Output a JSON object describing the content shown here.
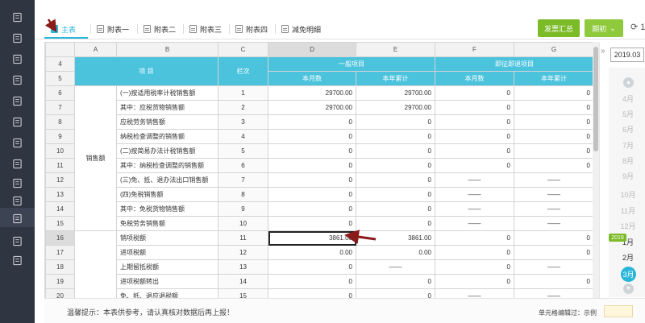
{
  "sidebar": {
    "icons": [
      "report-icon",
      "ledger-icon",
      "invoice-icon",
      "chart-icon",
      "voucher-icon",
      "calendar-icon",
      "document-icon",
      "archive-icon",
      "wallet-icon",
      "payroll-icon",
      "tax-icon",
      "search-report-icon",
      "settings-icon"
    ]
  },
  "tabs": [
    {
      "label": "主表",
      "active": true
    },
    {
      "label": "附表一",
      "active": false
    },
    {
      "label": "附表二",
      "active": false
    },
    {
      "label": "附表三",
      "active": false
    },
    {
      "label": "附表四",
      "active": false
    },
    {
      "label": "减免明细",
      "active": false
    }
  ],
  "toolbar": {
    "summary_label": "发票汇总",
    "period_label": "期初",
    "refresh_label": "⟳ 1"
  },
  "grid": {
    "col_letters": [
      "",
      "A",
      "B",
      "C",
      "D",
      "E",
      "F",
      "G"
    ],
    "header": {
      "item": "项 目",
      "seq": "栏次",
      "general": "一般项目",
      "refund": "即征即退项目",
      "this_month": "本月数",
      "year_total": "本年累计"
    },
    "header_rows": [
      "4",
      "5"
    ],
    "group_label": "销售额",
    "rows": [
      {
        "n": "6",
        "b": "(一)按适用税率计税销售额",
        "c": "1",
        "d": "29700.00",
        "e": "29700.00",
        "f": "0",
        "g": "0"
      },
      {
        "n": "7",
        "b": "其中：应税货物销售额",
        "c": "2",
        "d": "29700.00",
        "e": "29700.00",
        "f": "0",
        "g": "0"
      },
      {
        "n": "8",
        "b": "应税劳务销售额",
        "c": "3",
        "d": "0",
        "e": "0",
        "f": "0",
        "g": "0"
      },
      {
        "n": "9",
        "b": "纳税检查调整的销售额",
        "c": "4",
        "d": "0",
        "e": "0",
        "f": "0",
        "g": "0"
      },
      {
        "n": "10",
        "b": "(二)按简易办法计税销售额",
        "c": "5",
        "d": "0",
        "e": "0",
        "f": "0",
        "g": "0"
      },
      {
        "n": "11",
        "b": "其中：纳税检查调整的销售额",
        "c": "6",
        "d": "0",
        "e": "0",
        "f": "0",
        "g": "0"
      },
      {
        "n": "12",
        "b": "(三)免、抵、退办法出口销售额",
        "c": "7",
        "d": "0",
        "e": "0",
        "f": "——",
        "g": "——"
      },
      {
        "n": "13",
        "b": "(四)免税销售额",
        "c": "8",
        "d": "0",
        "e": "0",
        "f": "——",
        "g": "——"
      },
      {
        "n": "14",
        "b": "其中：免税货物销售额",
        "c": "9",
        "d": "0",
        "e": "0",
        "f": "——",
        "g": "——"
      },
      {
        "n": "15",
        "b": "免税劳务销售额",
        "c": "10",
        "d": "0",
        "e": "0",
        "f": "——",
        "g": "——"
      },
      {
        "n": "16",
        "b": "销项税额",
        "c": "11",
        "d": "3861.00",
        "e": "3861.00",
        "f": "0",
        "g": "0"
      },
      {
        "n": "17",
        "b": "进项税额",
        "c": "12",
        "d": "0.00",
        "e": "0.00",
        "f": "0",
        "g": "0"
      },
      {
        "n": "18",
        "b": "上期留抵税额",
        "c": "13",
        "d": "0",
        "e": "——",
        "f": "0",
        "g": "——"
      },
      {
        "n": "19",
        "b": "进项税额转出",
        "c": "14",
        "d": "0",
        "e": "0",
        "f": "0",
        "g": "0"
      },
      {
        "n": "20",
        "b": "免、抵、退应退税额",
        "c": "15",
        "d": "0",
        "e": "0",
        "f": "——",
        "g": "——"
      }
    ],
    "selected_cell": "D16"
  },
  "month_panel": {
    "year": "2019.03",
    "prev_year_months": [
      "4月",
      "5月",
      "6月",
      "7月",
      "8月",
      "9月",
      "10月",
      "11月",
      "12月"
    ],
    "year_badge": "2019",
    "current_months": [
      "1月",
      "2月"
    ],
    "selected_month": "3月"
  },
  "footer": {
    "tip": "温馨提示：本表供参考，请认真核对数据后再上报！",
    "legend": "单元格编辑过：示例"
  },
  "colors": {
    "accent": "#29b6d8",
    "header_bg": "#4cc3dd",
    "green": "#7cbb28",
    "sidebar": "#2f3541",
    "annotation": "#8b1a1a"
  }
}
